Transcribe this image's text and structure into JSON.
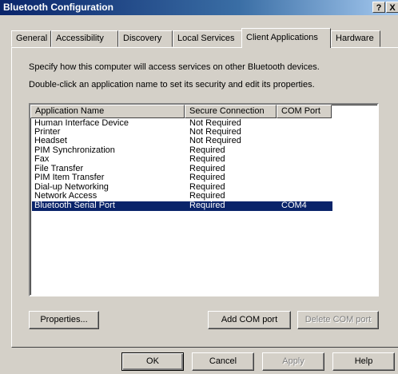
{
  "window": {
    "title": "Bluetooth Configuration",
    "help_glyph": "?",
    "close_glyph": "X"
  },
  "tabs": [
    {
      "label": "General"
    },
    {
      "label": "Accessibility"
    },
    {
      "label": "Discovery"
    },
    {
      "label": "Local Services"
    },
    {
      "label": "Client Applications",
      "active": true
    },
    {
      "label": "Hardware"
    }
  ],
  "description": {
    "line1": "Specify how this computer will access services on other Bluetooth devices.",
    "line2": "Double-click an application name to set its security and edit its properties."
  },
  "table": {
    "columns": [
      "Application Name",
      "Secure Connection",
      "COM Port"
    ],
    "rows": [
      {
        "name": "Human Interface Device",
        "secure": "Not Required",
        "com": ""
      },
      {
        "name": "Printer",
        "secure": "Not Required",
        "com": ""
      },
      {
        "name": "Headset",
        "secure": "Not Required",
        "com": ""
      },
      {
        "name": "PIM Synchronization",
        "secure": "Required",
        "com": ""
      },
      {
        "name": "Fax",
        "secure": "Required",
        "com": ""
      },
      {
        "name": "File Transfer",
        "secure": "Required",
        "com": ""
      },
      {
        "name": "PIM Item Transfer",
        "secure": "Required",
        "com": ""
      },
      {
        "name": "Dial-up Networking",
        "secure": "Required",
        "com": ""
      },
      {
        "name": "Network Access",
        "secure": "Required",
        "com": ""
      },
      {
        "name": "Bluetooth Serial Port",
        "secure": "Required",
        "com": "COM4",
        "selected": true
      }
    ]
  },
  "panel_buttons": {
    "properties": "Properties...",
    "add_com": "Add COM port",
    "delete_com": "Delete COM port"
  },
  "dialog_buttons": {
    "ok": "OK",
    "cancel": "Cancel",
    "apply": "Apply",
    "help": "Help"
  },
  "colors": {
    "selection": "#0a246a",
    "face": "#d4d0c8",
    "titlebar": "#0a246a"
  }
}
